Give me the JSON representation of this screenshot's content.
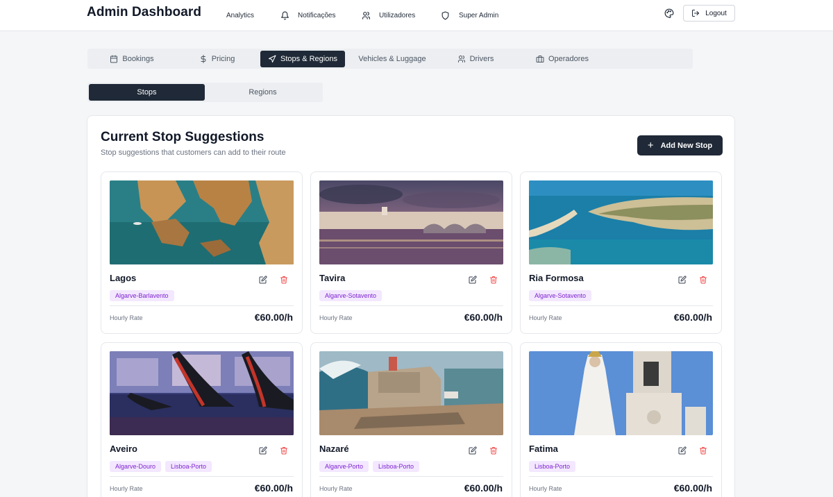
{
  "header": {
    "brand": "Admin Dashboard",
    "nav": [
      {
        "label": "Analytics",
        "icon": "none"
      },
      {
        "label": "Notificações",
        "icon": "bell-icon"
      },
      {
        "label": "Utilizadores",
        "icon": "users-icon"
      },
      {
        "label": "Super Admin",
        "icon": "shield-icon"
      }
    ],
    "logout_label": "Logout"
  },
  "tabs": [
    {
      "label": "Bookings",
      "icon": "calendar-icon"
    },
    {
      "label": "Pricing",
      "icon": "dollar-icon"
    },
    {
      "label": "Stops & Regions",
      "icon": "navigation-icon",
      "active": true
    },
    {
      "label": "Vehicles & Luggage",
      "icon": "none"
    },
    {
      "label": "Drivers",
      "icon": "users-icon"
    },
    {
      "label": "Operadores",
      "icon": "briefcase-icon"
    }
  ],
  "subtabs": [
    {
      "label": "Stops",
      "active": true
    },
    {
      "label": "Regions",
      "active": false
    }
  ],
  "panel": {
    "title": "Current Stop Suggestions",
    "subtitle": "Stop suggestions that customers can add to their route",
    "add_button": "Add New Stop"
  },
  "stops": [
    {
      "name": "Lagos",
      "tags": [
        "Algarve-Barlavento"
      ],
      "rate_label": "Hourly Rate",
      "rate": "€60.00/h"
    },
    {
      "name": "Tavira",
      "tags": [
        "Algarve-Sotavento"
      ],
      "rate_label": "Hourly Rate",
      "rate": "€60.00/h"
    },
    {
      "name": "Ria Formosa",
      "tags": [
        "Algarve-Sotavento"
      ],
      "rate_label": "Hourly Rate",
      "rate": "€60.00/h"
    },
    {
      "name": "Aveiro",
      "tags": [
        "Algarve-Douro",
        "Lisboa-Porto"
      ],
      "rate_label": "Hourly Rate",
      "rate": "€60.00/h"
    },
    {
      "name": "Nazaré",
      "tags": [
        "Algarve-Porto",
        "Lisboa-Porto"
      ],
      "rate_label": "Hourly Rate",
      "rate": "€60.00/h"
    },
    {
      "name": "Fatima",
      "tags": [
        "Lisboa-Porto"
      ],
      "rate_label": "Hourly Rate",
      "rate": "€60.00/h"
    }
  ],
  "colors": {
    "primary_dark": "#1f2937",
    "tag_bg": "#f3e8ff",
    "tag_text": "#7e22ce",
    "delete_red": "#ef4444"
  }
}
